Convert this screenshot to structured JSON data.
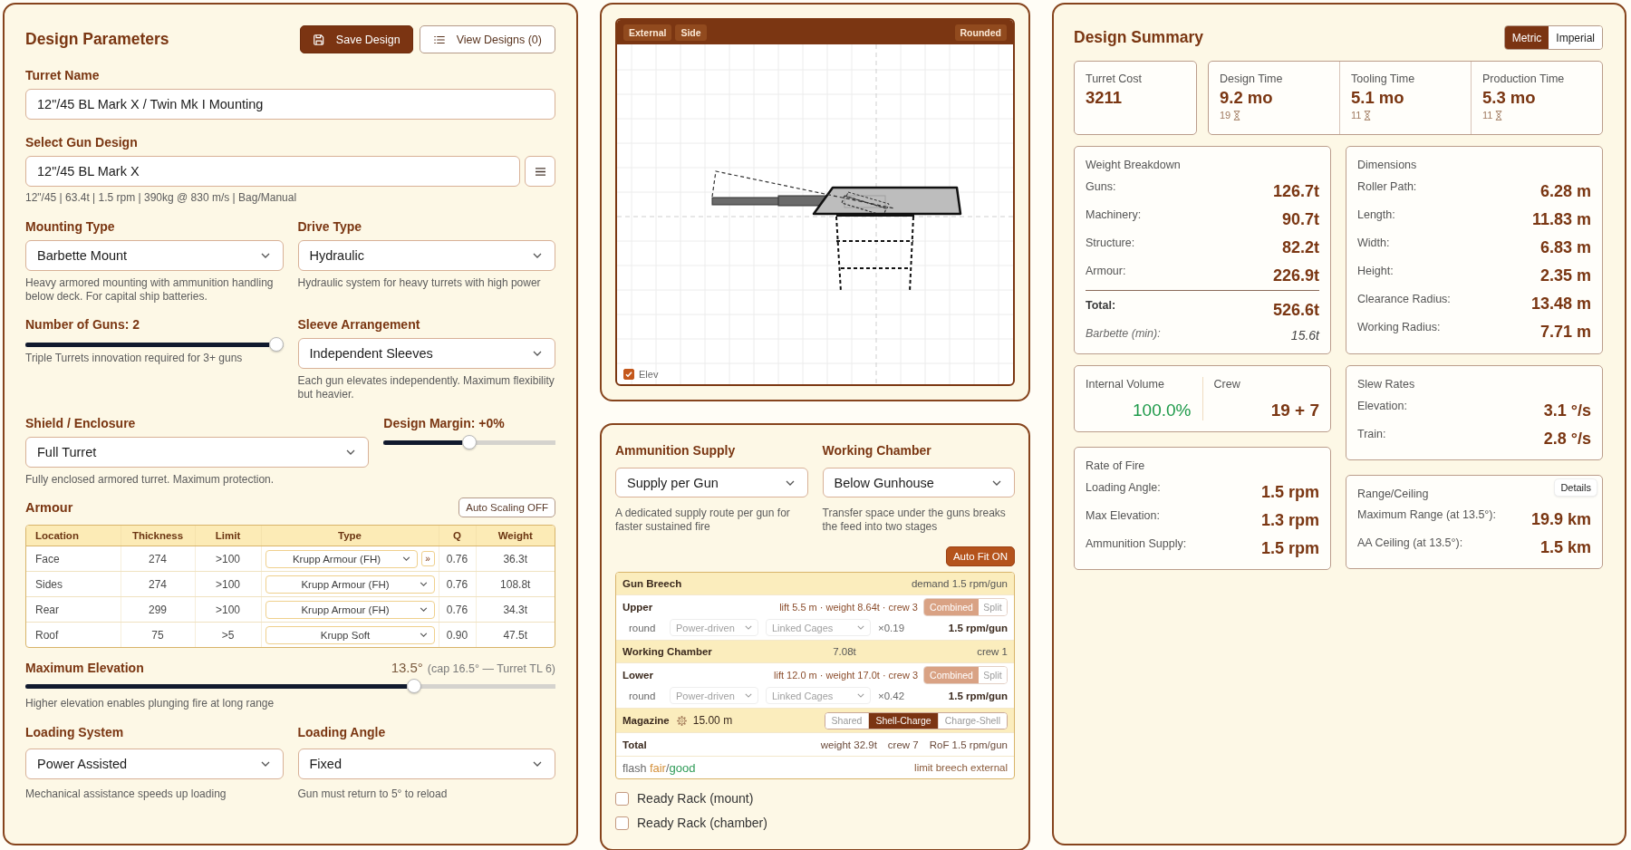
{
  "parameters": {
    "title": "Design Parameters",
    "actions": [
      {
        "label": "Save Design",
        "kind": "primary"
      },
      {
        "label": "View Designs (0)",
        "kind": "secondary"
      }
    ],
    "turret_name": {
      "label": "Turret Name",
      "value": "12\"/45 BL Mark X / Twin Mk I Mounting"
    },
    "gun_design": {
      "label": "Select Gun Design",
      "value": "12\"/45 BL Mark X",
      "summary": "12\"/45 | 63.4t | 1.5 rpm | 390kg @ 830 m/s | Bag/Manual"
    },
    "mounting_type": {
      "label": "Mounting Type",
      "value": "Barbette Mount",
      "hint": "Heavy armored mounting with ammunition handling below deck. For capital ship batteries."
    },
    "drive_type": {
      "label": "Drive Type",
      "value": "Hydraulic",
      "hint": "Hydraulic system for heavy turrets with high power"
    },
    "number_of_guns": {
      "label": "Number of Guns: 2",
      "level": 1,
      "hint": "Triple Turrets innovation required for 3+ guns"
    },
    "sleeve_arrangement": {
      "label": "Sleeve Arrangement",
      "value": "Independent Sleeves",
      "hint": "Each gun elevates independently. Maximum flexibility but heavier."
    },
    "shield": {
      "label": "Shield / Enclosure",
      "value": "Full Turret",
      "hint": "Fully enclosed armored turret. Maximum protection."
    },
    "design_margin": {
      "label": "Design Margin: +0%",
      "level": 0.5
    },
    "armour": {
      "title": "Armour",
      "auto_scaling": {
        "label": "Auto Scaling OFF",
        "on": false
      },
      "columns": [
        "Location",
        "Thickness",
        "Limit",
        "Type",
        "Q",
        "Weight"
      ],
      "rows": [
        {
          "location": "Face",
          "thickness": "274",
          "limit": ">100",
          "type": "Krupp Armour (FH)",
          "action": "»",
          "q": "0.76",
          "weight": "36.3t"
        },
        {
          "location": "Sides",
          "thickness": "274",
          "limit": ">100",
          "type": "Krupp Armour (FH)",
          "q": "0.76",
          "weight": "108.8t"
        },
        {
          "location": "Rear",
          "thickness": "299",
          "limit": ">100",
          "type": "Krupp Armour (FH)",
          "q": "0.76",
          "weight": "34.3t"
        },
        {
          "location": "Roof",
          "thickness": "75",
          "limit": ">5",
          "type": "Krupp Soft",
          "q": "0.90",
          "weight": "47.5t"
        }
      ]
    },
    "maximum_elevation": {
      "label": "Maximum Elevation",
      "value": "13.5°",
      "note": "(cap 16.5° — Turret TL 6)",
      "level": 0.74,
      "hint": "Higher elevation enables plunging fire at long range"
    },
    "loading_system": {
      "label": "Loading System",
      "value": "Power Assisted",
      "hint": "Mechanical assistance speeds up loading"
    },
    "loading_angle": {
      "label": "Loading Angle",
      "value": "Fixed",
      "hint": "Gun must return to 5° to reload"
    }
  },
  "diagram": {
    "views": [
      {
        "label": "External"
      },
      {
        "label": "Side"
      }
    ],
    "style": "Rounded",
    "elevation_toggle": {
      "label": "Elev",
      "checked": true
    }
  },
  "ammunition": {
    "supply": {
      "label": "Ammunition Supply",
      "value": "Supply per Gun",
      "hint": "A dedicated supply route per gun for faster sustained fire"
    },
    "working_chamber": {
      "label": "Working Chamber",
      "value": "Below Gunhouse",
      "hint": "Transfer space under the guns breaks the feed into two stages"
    },
    "auto_fit": {
      "label": "Auto Fit ON",
      "on": true
    },
    "feed": [
      {
        "kind": "stage",
        "name": "Gun Breech",
        "detail": "demand 1.5 rpm/gun"
      },
      {
        "kind": "hoist",
        "name": "Upper",
        "stats": "lift 5.5 m · weight 8.64t · crew 3",
        "disabled": true,
        "modes": [
          {
            "label": "Combined",
            "selected": true
          },
          {
            "label": "Split",
            "selected": false
          }
        ],
        "load": "round",
        "drive": "Power-driven",
        "cage": "Linked Cages",
        "factor": "×0.19",
        "rate": "1.5 rpm/gun"
      },
      {
        "kind": "stage",
        "name": "Working Chamber",
        "weight": "7.08t",
        "detail": "crew 1"
      },
      {
        "kind": "hoist",
        "name": "Lower",
        "stats": "lift 12.0 m · weight 17.0t · crew 3",
        "disabled": true,
        "modes": [
          {
            "label": "Combined",
            "selected": true
          },
          {
            "label": "Split",
            "selected": false
          }
        ],
        "load": "round",
        "drive": "Power-driven",
        "cage": "Linked Cages",
        "factor": "×0.42",
        "rate": "1.5 rpm/gun"
      },
      {
        "kind": "magazine",
        "name": "Magazine",
        "depth": "15.00 m",
        "modes": [
          {
            "label": "Shared",
            "selected": false
          },
          {
            "label": "Shell-Charge",
            "selected": true
          },
          {
            "label": "Charge-Shell",
            "selected": false
          }
        ]
      },
      {
        "kind": "total",
        "name": "Total",
        "values": [
          "weight 32.9t",
          "crew 7",
          "RoF 1.5 rpm/gun"
        ]
      },
      {
        "kind": "flash",
        "name": "flash",
        "ratings": [
          {
            "text": "fair",
            "color": "#d4903a"
          },
          {
            "text": "good",
            "color": "#2e9b57"
          }
        ],
        "separator": "/",
        "limit": "limit breech external"
      }
    ],
    "ready_racks": [
      {
        "label": "Ready Rack (mount)",
        "checked": false
      },
      {
        "label": "Ready Rack (chamber)",
        "checked": false
      }
    ]
  },
  "summary": {
    "title": "Design Summary",
    "units": [
      {
        "label": "Metric",
        "selected": true
      },
      {
        "label": "Imperial",
        "selected": false
      }
    ],
    "cost": {
      "label": "Turret Cost",
      "value": "3211"
    },
    "times": [
      {
        "label": "Design Time",
        "value": "9.2 mo",
        "note": "19"
      },
      {
        "label": "Tooling Time",
        "value": "5.1 mo",
        "note": "11"
      },
      {
        "label": "Production Time",
        "value": "5.3 mo",
        "note": "11"
      }
    ],
    "weight_breakdown": {
      "title": "Weight Breakdown",
      "rows": [
        {
          "label": "Guns:",
          "value": "126.7t"
        },
        {
          "label": "Machinery:",
          "value": "90.7t"
        },
        {
          "label": "Structure:",
          "value": "82.2t"
        },
        {
          "label": "Armour:",
          "value": "226.9t"
        }
      ],
      "total": {
        "label": "Total:",
        "value": "526.6t"
      },
      "barbette": {
        "label": "Barbette (min):",
        "value": "15.6t"
      }
    },
    "dimensions": {
      "title": "Dimensions",
      "rows": [
        {
          "label": "Roller Path:",
          "value": "6.28 m"
        },
        {
          "label": "Length:",
          "value": "11.83 m"
        },
        {
          "label": "Width:",
          "value": "6.83 m"
        },
        {
          "label": "Height:",
          "value": "2.35 m"
        },
        {
          "label": "Clearance Radius:",
          "value": "13.48 m"
        },
        {
          "label": "Working Radius:",
          "value": "7.71 m"
        }
      ]
    },
    "internal_volume": {
      "label": "Internal Volume",
      "value": "100.0%",
      "color": "#1e9a4a"
    },
    "crew": {
      "label": "Crew",
      "value": "19 + 7"
    },
    "slew_rates": {
      "title": "Slew Rates",
      "rows": [
        {
          "label": "Elevation:",
          "value": "3.1 °/s"
        },
        {
          "label": "Train:",
          "value": "2.8 °/s"
        }
      ]
    },
    "rate_of_fire": {
      "title": "Rate of Fire",
      "rows": [
        {
          "label": "Loading Angle:",
          "value": "1.5 rpm"
        },
        {
          "label": "Max Elevation:",
          "value": "1.3 rpm"
        },
        {
          "label": "Ammunition Supply:",
          "value": "1.5 rpm"
        }
      ]
    },
    "range_ceiling": {
      "title": "Range/Ceiling",
      "action": "Details",
      "rows": [
        {
          "label": "Maximum Range (at 13.5°):",
          "value": "19.9 km"
        },
        {
          "label": "AA Ceiling (at 13.5°):",
          "value": "1.5 km"
        }
      ]
    }
  }
}
